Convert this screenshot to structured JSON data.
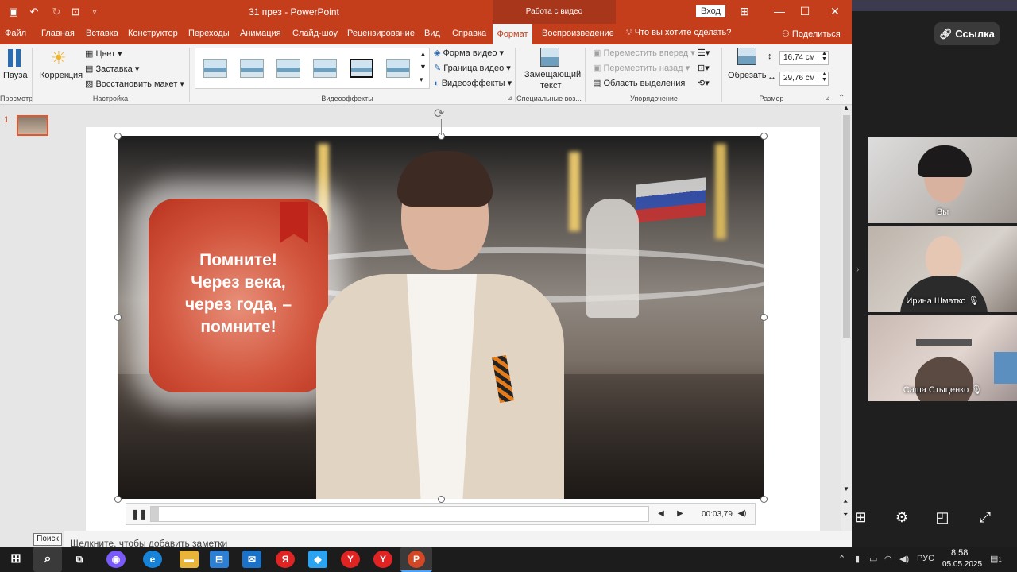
{
  "window": {
    "title": "31 през  -  PowerPoint",
    "context_tab_group": "Работа с видео",
    "signin_label": "Вход"
  },
  "tabs": [
    "Файл",
    "Главная",
    "Вставка",
    "Конструктор",
    "Переходы",
    "Анимация",
    "Слайд-шоу",
    "Рецензирование",
    "Вид",
    "Справка"
  ],
  "active_tab": "Формат",
  "playback_tab": "Воспроизведение",
  "tell_me": "Что вы хотите сделать?",
  "share_label": "Поделиться",
  "ribbon": {
    "preview": {
      "pause_label": "Пауза",
      "group_label": "Просмотр"
    },
    "adjust": {
      "correction_label": "Коррекция",
      "color_label": "Цвет",
      "poster_label": "Заставка",
      "reset_label": "Восстановить макет",
      "group_label": "Настройка"
    },
    "video_styles": {
      "shape_label": "Форма видео",
      "border_label": "Граница видео",
      "effects_label": "Видеоэффекты",
      "group_label": "Видеоэффекты"
    },
    "accessibility": {
      "alt_text_line1": "Замещающий",
      "alt_text_line2": "текст",
      "group_label": "Специальные воз..."
    },
    "arrange": {
      "bring_forward": "Переместить вперед",
      "send_backward": "Переместить назад",
      "selection_pane": "Область выделения",
      "group_label": "Упорядочение"
    },
    "size": {
      "crop_label": "Обрезать",
      "height_value": "16,74 см",
      "width_value": "29,76 см",
      "group_label": "Размер"
    }
  },
  "slides_pane": {
    "slide_number": "1"
  },
  "slide": {
    "bubble_text": "Помните!\nЧерез века,\nчерез года, –\nпомните!"
  },
  "player": {
    "timecode": "00:03,79",
    "progress": 0.016
  },
  "notes_placeholder": "Щелкните, чтобы добавить заметки",
  "search_tooltip": "Поиск",
  "meet": {
    "link_label": "Ссылка",
    "participants": [
      "Вы",
      "Ирина Шматко",
      "Саша Стыценко"
    ]
  },
  "tray": {
    "language": "РУС",
    "time": "8:58",
    "date": "05.05.2025",
    "notification_count": "1"
  },
  "colors": {
    "accent": "#c43e1c",
    "context_tab": "#a8361a"
  }
}
